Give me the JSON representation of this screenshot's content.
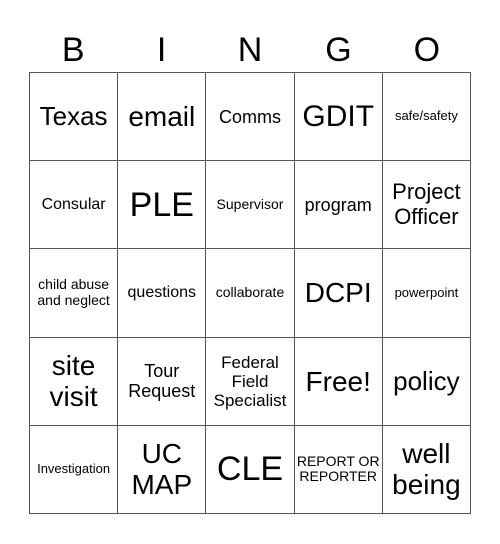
{
  "header": [
    "B",
    "I",
    "N",
    "G",
    "O"
  ],
  "cells": [
    [
      "Texas",
      "email",
      "Comms",
      "GDIT",
      "safe/safety"
    ],
    [
      "Consular",
      "PLE",
      "Supervisor",
      "program",
      "Project Officer"
    ],
    [
      "child abuse and neglect",
      "questions",
      "collaborate",
      "DCPI",
      "powerpoint"
    ],
    [
      "site visit",
      "Tour Request",
      "Federal Field Specialist",
      "Free!",
      "policy"
    ],
    [
      "Investigation",
      "UC MAP",
      "CLE",
      "REPORT OR REPORTER",
      "well being"
    ]
  ]
}
